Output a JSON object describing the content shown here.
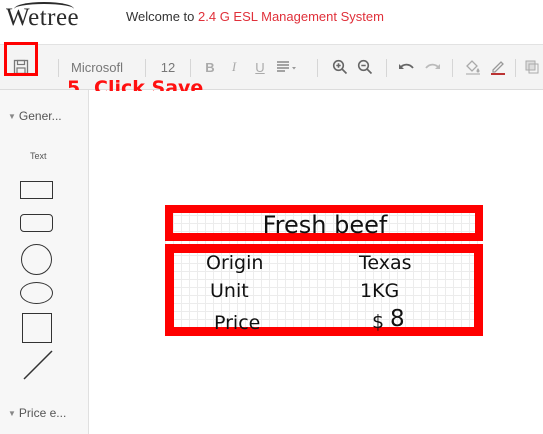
{
  "header": {
    "logo": "Wetree",
    "welcome_prefix": "Welcome to ",
    "system_name": "2.4 G ESL Management System"
  },
  "toolbar": {
    "font_family": "Microsofl",
    "font_size": "12",
    "icons": [
      "save-icon",
      "bold-icon",
      "italic-icon",
      "underline-icon",
      "align-icon",
      "zoom-in-icon",
      "zoom-out-icon",
      "undo-icon",
      "redo-icon",
      "fill-color-icon",
      "line-color-icon",
      "shadow-icon"
    ]
  },
  "callout": "5. Click Save",
  "sidebar": {
    "section1": "Gener...",
    "text_tool": "Text",
    "shapes": [
      "rectangle",
      "rounded-rectangle",
      "circle",
      "ellipse",
      "square",
      "line"
    ],
    "section2": "Price e..."
  },
  "label": {
    "title": "Fresh beef",
    "origin_label": "Origin",
    "origin_value": "Texas",
    "unit_label": "Unit",
    "unit_value": "1KG",
    "price_label": "Price",
    "price_currency": "$",
    "price_value": "8"
  },
  "colors": {
    "highlight": "#ff0000",
    "brand": "#e0303a"
  }
}
